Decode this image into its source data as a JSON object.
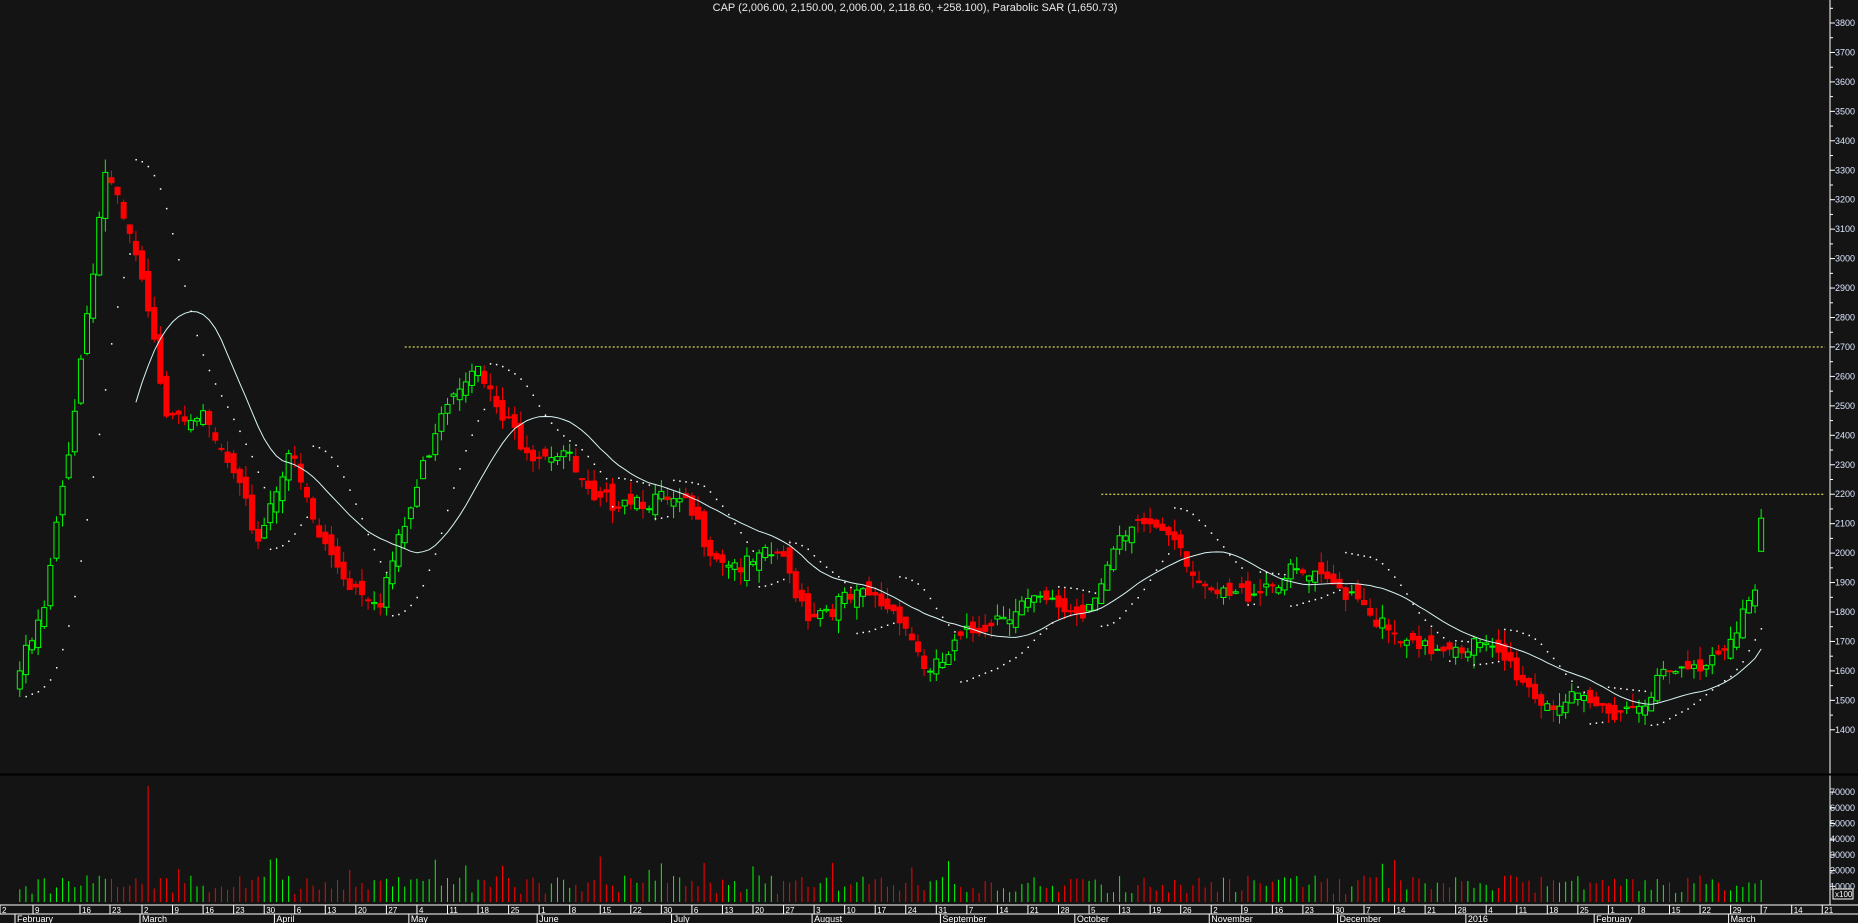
{
  "chart_data": {
    "type": "candlestick",
    "title": "CAP (2,006.00, 2,150.00, 2,006.00, 2,118.60, +258.100), Parabolic SAR (1,650.73)",
    "symbol": "CAP",
    "last_bar": {
      "open": 2006.0,
      "high": 2150.0,
      "low": 2006.0,
      "close": 2118.6,
      "change": 258.1
    },
    "parabolic_sar_last": 1650.73,
    "weekly_closes_approx": [
      1800,
      2500,
      3300,
      3000,
      2500,
      2480,
      2300,
      2050,
      2350,
      2050,
      1900,
      1850,
      2150,
      2500,
      2650,
      2450,
      2350,
      2350,
      2150,
      2200,
      2180,
      2150,
      2000,
      1950,
      2000,
      1800,
      1830,
      1850,
      1800,
      1580,
      1700,
      1780,
      1830,
      1820,
      1800,
      2000,
      2100,
      2080,
      1850,
      1850,
      1900,
      1930,
      1890,
      1870,
      1720,
      1660,
      1700,
      1680,
      1620,
      1500,
      1490,
      1470,
      1480,
      1580,
      1600,
      1700,
      1860
    ],
    "start_price": 1550,
    "moving_average_period": 20,
    "resistance_lines": [
      {
        "price": 2700,
        "from_day": 63
      },
      {
        "price": 2200,
        "from_day": 177
      }
    ],
    "price_axis": {
      "min": 1400,
      "max": 3800,
      "step": 100,
      "ticks": [
        "1400",
        "1500",
        "1600",
        "1700",
        "1800",
        "1900",
        "2000",
        "2100",
        "2200",
        "2300",
        "2400",
        "2500",
        "2600",
        "2700",
        "2800",
        "2900",
        "3000",
        "3100",
        "3200",
        "3300",
        "3400",
        "3500",
        "3600",
        "3700",
        "3800"
      ]
    },
    "volume_axis": {
      "unit_label": "x100",
      "ticks": [
        "10000",
        "20000",
        "30000",
        "40000",
        "50000",
        "60000",
        "70000"
      ],
      "max": 75000
    },
    "x_day_ticks": [
      "2",
      "9",
      "16",
      "23",
      "2",
      "9",
      "16",
      "23",
      "30",
      "6",
      "13",
      "20",
      "27",
      "4",
      "11",
      "18",
      "25",
      "1",
      "8",
      "15",
      "22",
      "30",
      "6",
      "13",
      "20",
      "27",
      "3",
      "10",
      "17",
      "24",
      "31",
      "7",
      "14",
      "21",
      "28",
      "5",
      "13",
      "19",
      "26",
      "2",
      "9",
      "16",
      "23",
      "30",
      "7",
      "14",
      "21",
      "28",
      "4",
      "11",
      "18",
      "25",
      "1",
      "8",
      "15",
      "22",
      "29",
      "7",
      "14",
      "21"
    ],
    "x_months": [
      {
        "label": "February",
        "day": 0
      },
      {
        "label": "March",
        "day": 20
      },
      {
        "label": "April",
        "day": 42
      },
      {
        "label": "May",
        "day": 64
      },
      {
        "label": "June",
        "day": 85
      },
      {
        "label": "July",
        "day": 107
      },
      {
        "label": "August",
        "day": 130
      },
      {
        "label": "September",
        "day": 151
      },
      {
        "label": "October",
        "day": 173
      },
      {
        "label": "November",
        "day": 195
      },
      {
        "label": "December",
        "day": 216
      },
      {
        "label": "2016",
        "day": 237
      },
      {
        "label": "February",
        "day": 258
      },
      {
        "label": "March",
        "day": 280
      }
    ],
    "colors": {
      "up": "#00ff00",
      "down": "#ff0000",
      "ma": "#d8f4f4",
      "sar": "#ffffff",
      "resistance": "#ffff66",
      "background": "#141414"
    }
  }
}
